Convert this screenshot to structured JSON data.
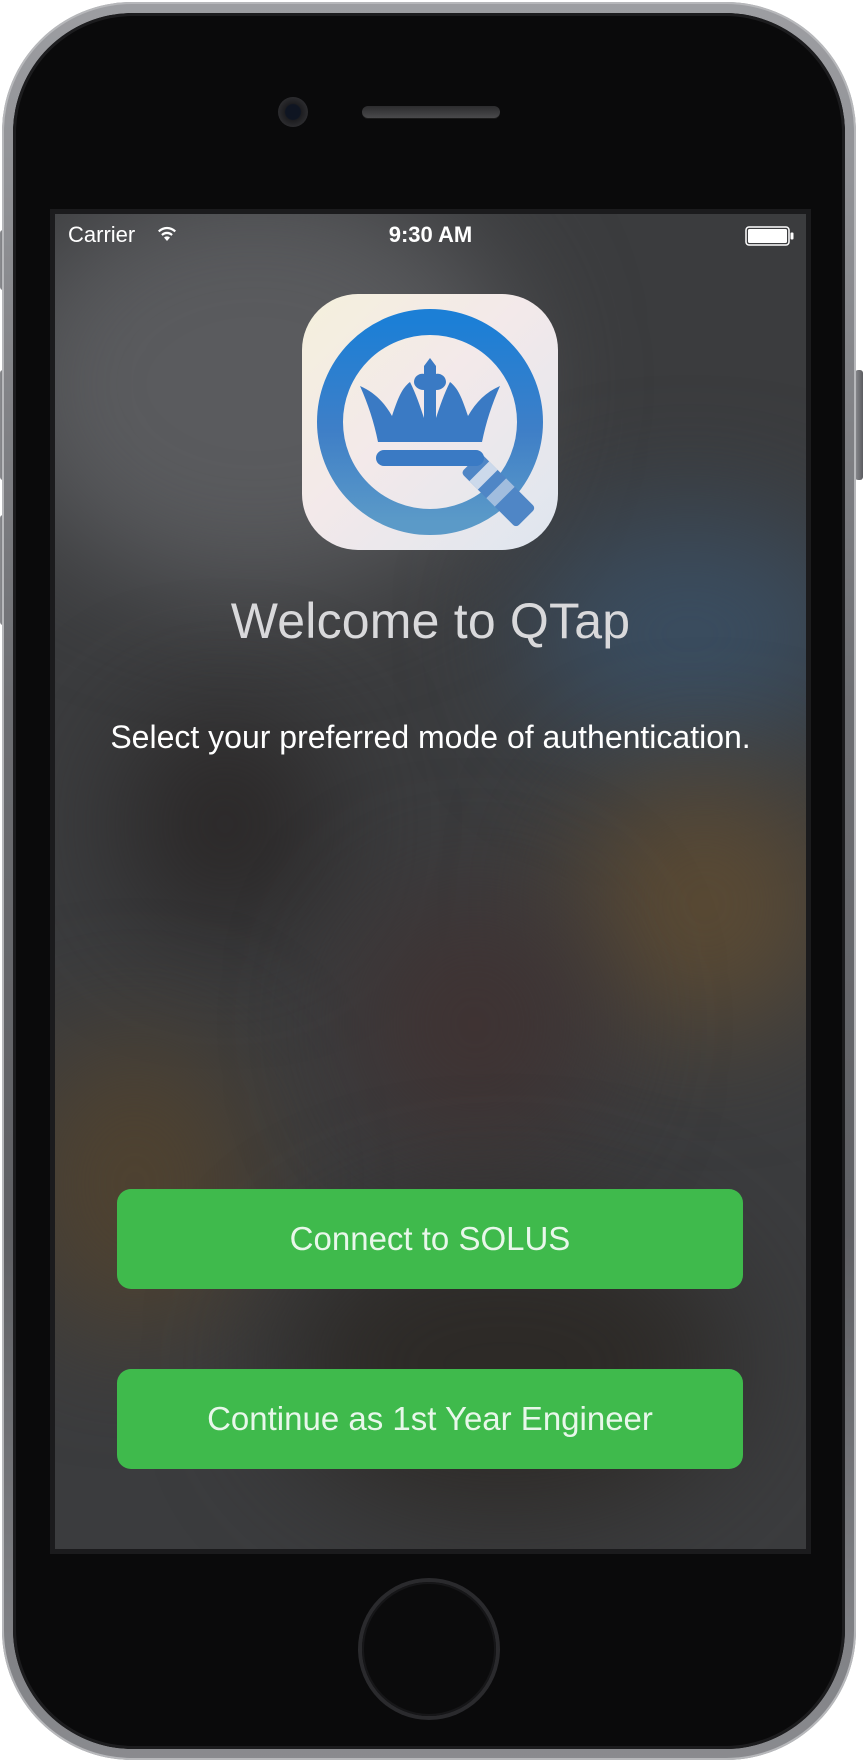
{
  "status_bar": {
    "carrier": "Carrier",
    "time": "9:30 AM",
    "wifi_icon": "wifi-icon",
    "battery_icon": "battery-full-icon"
  },
  "app": {
    "icon": "qtap-crown-magnifier-logo",
    "welcome_title": "Welcome to QTap",
    "subtitle": "Select your preferred mode of authentication."
  },
  "actions": {
    "connect_label": "Connect to SOLUS",
    "first_year_label": "Continue as 1st Year Engineer"
  },
  "colors": {
    "button_green": "#3fba4c",
    "logo_blue": "#2a7fd0",
    "screen_background": "#3b3c3e"
  }
}
